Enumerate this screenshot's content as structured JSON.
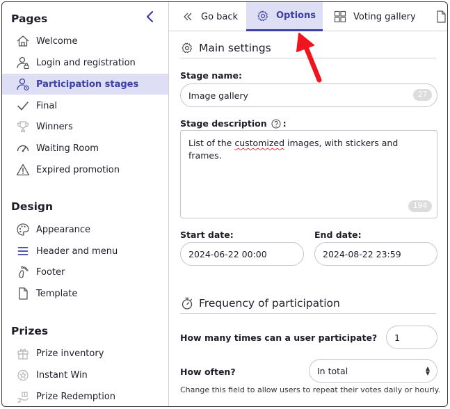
{
  "sidebar": {
    "sections": [
      {
        "title": "Pages",
        "items": [
          {
            "label": "Welcome",
            "icon": "home-icon"
          },
          {
            "label": "Login and registration",
            "icon": "user-lock-icon"
          },
          {
            "label": "Participation stages",
            "icon": "user-cycle-icon",
            "active": true
          },
          {
            "label": "Final",
            "icon": "check-icon"
          },
          {
            "label": "Winners",
            "icon": "trophy-icon"
          },
          {
            "label": "Waiting Room",
            "icon": "gauge-icon"
          },
          {
            "label": "Expired promotion",
            "icon": "warning-icon"
          }
        ]
      },
      {
        "title": "Design",
        "items": [
          {
            "label": "Appearance",
            "icon": "palette-icon"
          },
          {
            "label": "Header and menu",
            "icon": "menu-icon"
          },
          {
            "label": "Footer",
            "icon": "foot-icon"
          },
          {
            "label": "Template",
            "icon": "file-icon"
          }
        ]
      },
      {
        "title": "Prizes",
        "items": [
          {
            "label": "Prize inventory",
            "icon": "gift-icon"
          },
          {
            "label": "Instant Win",
            "icon": "instant-win-icon"
          },
          {
            "label": "Prize Redemption",
            "icon": "redeem-icon"
          }
        ]
      }
    ]
  },
  "tabs": [
    {
      "label": "Go back",
      "icon": "double-chevron-left-icon"
    },
    {
      "label": "Options",
      "icon": "gear-icon",
      "active": true
    },
    {
      "label": "Voting gallery",
      "icon": "grid-icon"
    },
    {
      "label": "",
      "icon": "file-icon"
    }
  ],
  "main_settings": {
    "heading": "Main settings",
    "stage_name_label": "Stage name:",
    "stage_name_value": "Image gallery",
    "stage_name_count": "27",
    "stage_desc_label": "Stage description",
    "stage_desc_colon": ":",
    "stage_desc_before": "List of the ",
    "stage_desc_misspelled": "customized",
    "stage_desc_after": " images, with stickers and frames.",
    "stage_desc_count": "194",
    "start_label": "Start date:",
    "start_value": "2024-06-22 00:00",
    "end_label": "End date:",
    "end_value": "2024-08-22 23:59"
  },
  "frequency": {
    "heading": "Frequency of participation",
    "times_label": "How many times can a user participate?",
    "times_value": "1",
    "often_label": "How often?",
    "often_value": "In total",
    "often_hint": "Change this field to allow users to repeat their votes daily or hourly."
  },
  "colors": {
    "accent": "#3b3fa6",
    "active_bg": "#dedef5",
    "pointer_arrow": "#f0141e"
  }
}
